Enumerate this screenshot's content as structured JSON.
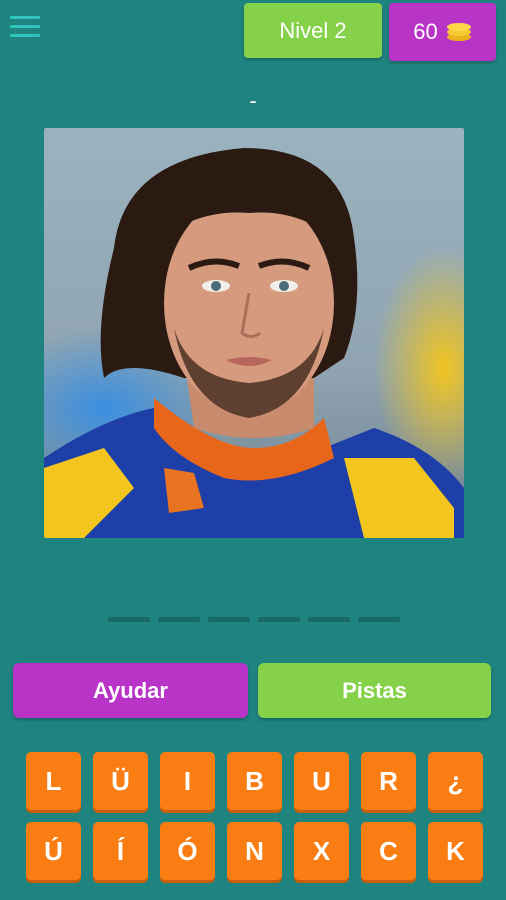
{
  "header": {
    "menu_icon": "hamburger-menu-icon",
    "level_label": "Nivel 2",
    "coins": "60",
    "coin_icon": "coin-stack-icon"
  },
  "answer_hint": "-",
  "answer_slot_count": 6,
  "actions": {
    "help_label": "Ayudar",
    "clues_label": "Pistas"
  },
  "letters": [
    "L",
    "Ü",
    "I",
    "B",
    "U",
    "R",
    "¿",
    "Ú",
    "Í",
    "Ó",
    "N",
    "X",
    "C",
    "K"
  ],
  "colors": {
    "background": "#1f8480",
    "green": "#86d14a",
    "purple": "#b734c7",
    "orange": "#f97d12",
    "menu_icon": "#2ec4bb"
  }
}
